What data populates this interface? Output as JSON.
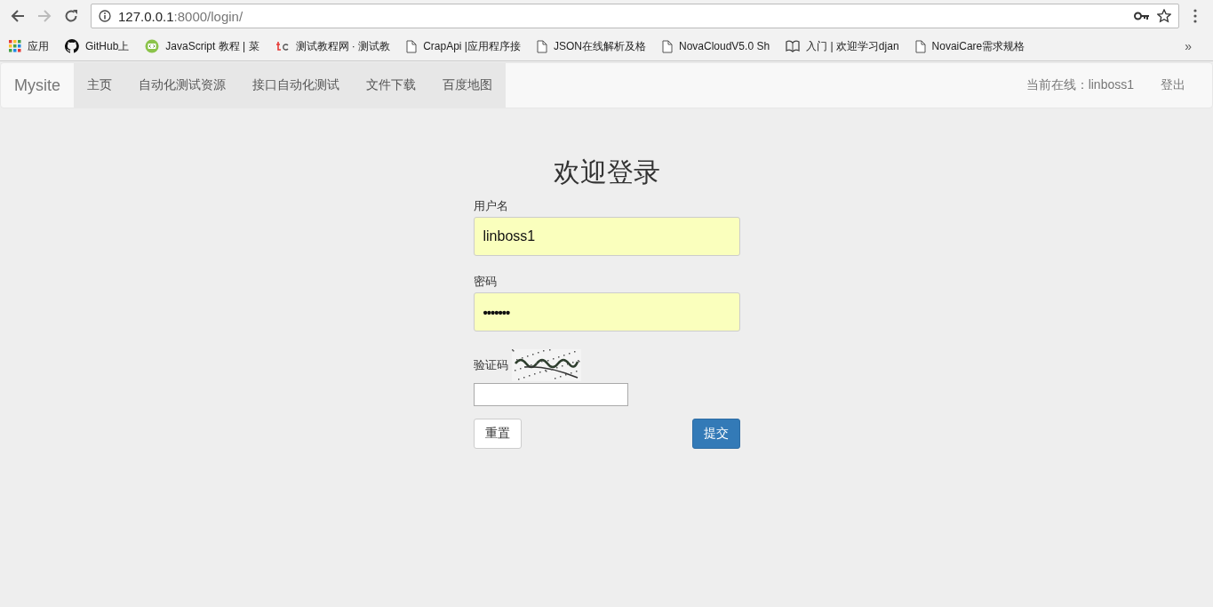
{
  "browser": {
    "url_host": "127.0.0.1",
    "url_rest": ":8000/login/",
    "bookmarks": [
      {
        "kind": "apps",
        "label": "应用"
      },
      {
        "kind": "github",
        "label": "GitHub上"
      },
      {
        "kind": "code",
        "label": "JavaScript 教程 | 菜"
      },
      {
        "kind": "tc",
        "label": "测试教程网 · 测试教"
      },
      {
        "kind": "page",
        "label": "CrapApi |应用程序接"
      },
      {
        "kind": "page",
        "label": "JSON在线解析及格"
      },
      {
        "kind": "page",
        "label": "NovaCloudV5.0 Sh"
      },
      {
        "kind": "book",
        "label": "入门 | 欢迎学习djan"
      },
      {
        "kind": "page",
        "label": "NovaiCare需求规格"
      }
    ],
    "overflow": "»"
  },
  "navbar": {
    "brand": "Mysite",
    "items": [
      {
        "label": "主页",
        "selected": true
      },
      {
        "label": "自动化测试资源",
        "selected": true
      },
      {
        "label": "接口自动化测试",
        "selected": true
      },
      {
        "label": "文件下载",
        "selected": true
      },
      {
        "label": "百度地图",
        "selected": true
      }
    ],
    "online": "当前在线：linboss1",
    "logout": "登出"
  },
  "form": {
    "title": "欢迎登录",
    "fields": [
      {
        "label": "用户名",
        "value": "linboss1",
        "kind": "text",
        "autofilled": true
      },
      {
        "label": "密码",
        "value": "•••••••",
        "kind": "password",
        "autofilled": true
      }
    ],
    "captcha": {
      "label": "验证码",
      "kind": "picture"
    },
    "reset": "重置",
    "submit": "提交"
  }
}
